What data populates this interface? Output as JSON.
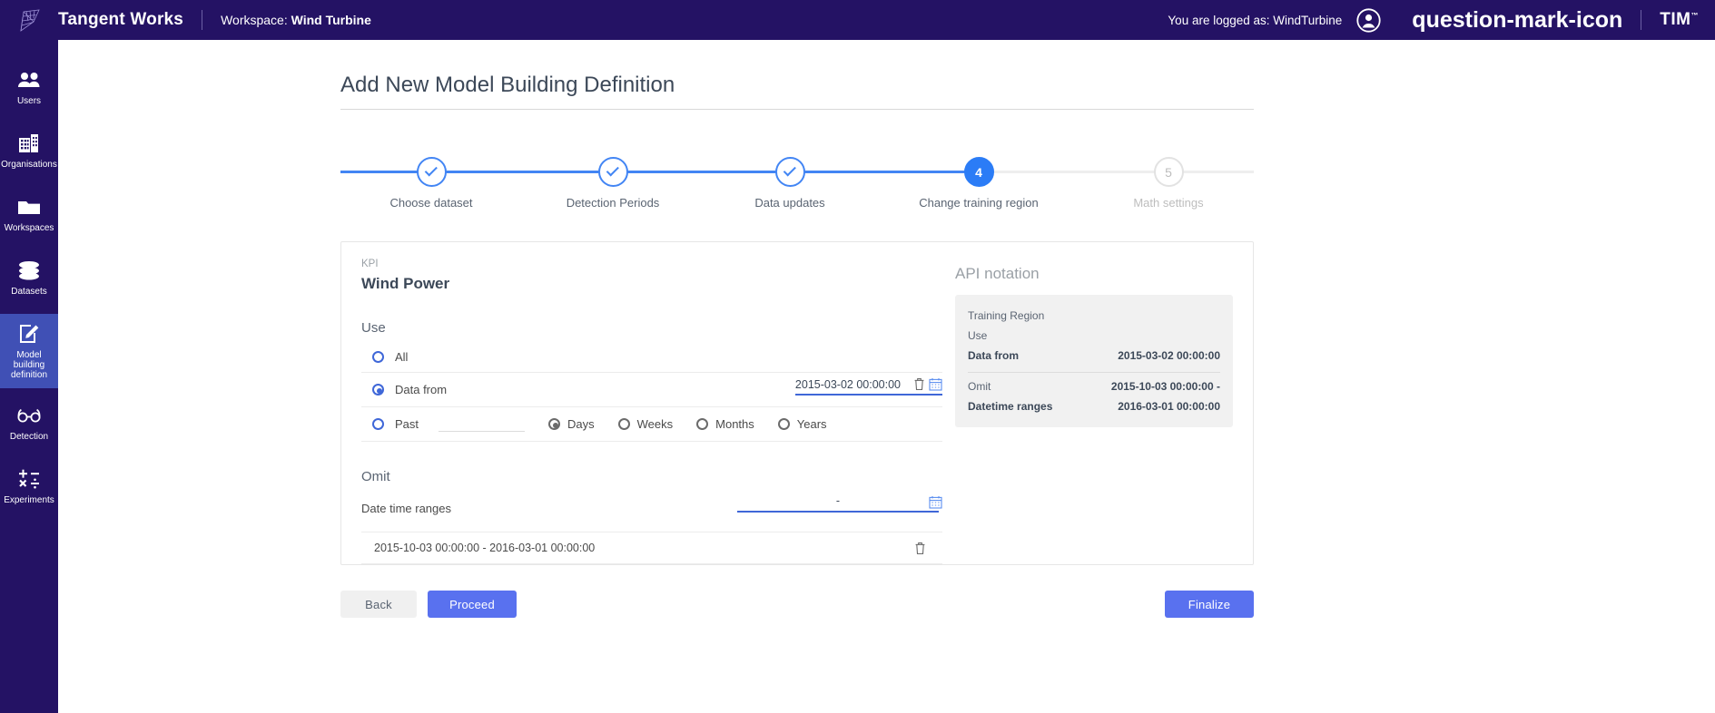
{
  "header": {
    "brand": "Tangent Works",
    "workspace_prefix": "Workspace: ",
    "workspace_name": "Wind Turbine",
    "logged_as": "You are logged as: WindTurbine",
    "avatar_icon": "user-circle-icon",
    "help_icon": "question-mark-icon",
    "product_logo": "TIM",
    "product_logo_tm": "™",
    "bg_color": "#241264"
  },
  "sidebar": {
    "active_color": "#4050b5",
    "items": [
      {
        "label": "Users",
        "icon": "users-icon"
      },
      {
        "label": "Organisations",
        "icon": "buildings-icon"
      },
      {
        "label": "Workspaces",
        "icon": "folder-icon"
      },
      {
        "label": "Datasets",
        "icon": "database-icon"
      },
      {
        "label": "Model building definition",
        "icon": "edit-square-icon"
      },
      {
        "label": "Detection",
        "icon": "glasses-icon"
      },
      {
        "label": "Experiments",
        "icon": "math-operators-icon"
      }
    ]
  },
  "page": {
    "title": "Add New Model Building Definition"
  },
  "stepper": {
    "current": 4,
    "accent_color": "#4285f4",
    "steps": [
      {
        "number": "1",
        "label": "Choose dataset",
        "state": "done"
      },
      {
        "number": "2",
        "label": "Detection Periods",
        "state": "done"
      },
      {
        "number": "3",
        "label": "Data updates",
        "state": "done"
      },
      {
        "number": "4",
        "label": "Change training region",
        "state": "current"
      },
      {
        "number": "5",
        "label": "Math settings",
        "state": "todo"
      }
    ]
  },
  "form": {
    "kpi_label": "KPI",
    "kpi_value": "Wind Power",
    "use_heading": "Use",
    "option_all": "All",
    "option_data_from": "Data from",
    "option_past": "Past",
    "past_value": "",
    "data_from_value": "2015-03-02 00:00:00",
    "delete_icon": "trash-icon",
    "calendar_icon": "calendar-icon",
    "units": [
      {
        "label": "Days",
        "selected": true
      },
      {
        "label": "Weeks",
        "selected": false
      },
      {
        "label": "Months",
        "selected": false
      },
      {
        "label": "Years",
        "selected": false
      }
    ],
    "omit_heading": "Omit",
    "date_time_ranges_label": "Date time ranges",
    "range_placeholder": "-",
    "omit_entries": [
      {
        "text": "2015-10-03 00:00:00 - 2016-03-01 00:00:00"
      }
    ]
  },
  "api_notation": {
    "title": "API notation",
    "rows": [
      {
        "key": "Training Region",
        "value": "",
        "bold": false
      },
      {
        "key": "Use",
        "value": "",
        "bold": false
      },
      {
        "key": "Data from",
        "value": "2015-03-02 00:00:00",
        "bold": true
      }
    ],
    "rows2": [
      {
        "key": "Omit",
        "value": "2015-10-03 00:00:00 -",
        "bold": false
      },
      {
        "key": "Datetime ranges",
        "value": "2016-03-01 00:00:00",
        "bold": true
      }
    ]
  },
  "footer": {
    "back": "Back",
    "proceed": "Proceed",
    "finalize": "Finalize",
    "primary_color": "#5971ef"
  }
}
